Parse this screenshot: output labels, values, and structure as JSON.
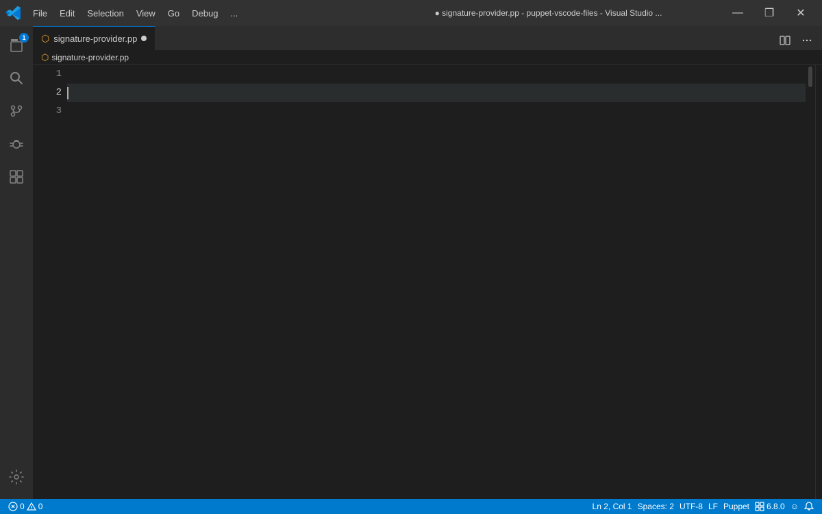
{
  "titlebar": {
    "title": "● signature-provider.pp - puppet-vscode-files - Visual Studio ...",
    "menus": [
      "File",
      "Edit",
      "Selection",
      "View",
      "Go",
      "Debug",
      "..."
    ],
    "controls": [
      "—",
      "❐",
      "✕"
    ]
  },
  "activity_bar": {
    "top_icons": [
      {
        "name": "explorer",
        "symbol": "📄",
        "badge": "1"
      },
      {
        "name": "search",
        "symbol": "🔍"
      },
      {
        "name": "source-control",
        "symbol": "⑂"
      },
      {
        "name": "debug",
        "symbol": "⑇"
      },
      {
        "name": "extensions",
        "symbol": "⊞"
      }
    ],
    "bottom_icons": [
      {
        "name": "settings",
        "symbol": "⚙"
      }
    ]
  },
  "tab": {
    "filename": "signature-provider.pp",
    "unsaved": true,
    "icon_color": "#e9a32b"
  },
  "breadcrumb": {
    "filename": "signature-provider.pp"
  },
  "editor": {
    "lines": [
      {
        "number": "1",
        "content": "",
        "active": false
      },
      {
        "number": "2",
        "content": "",
        "active": true
      },
      {
        "number": "3",
        "content": "",
        "active": false
      }
    ],
    "active_line": 2
  },
  "statusbar": {
    "errors": "0",
    "warnings": "0",
    "position": "Ln 2, Col 1",
    "spaces": "Spaces: 2",
    "encoding": "UTF-8",
    "line_ending": "LF",
    "language": "Puppet",
    "extension_version": "6.8.0",
    "feedback_icon": "☺",
    "notification_icon": "🔔"
  }
}
